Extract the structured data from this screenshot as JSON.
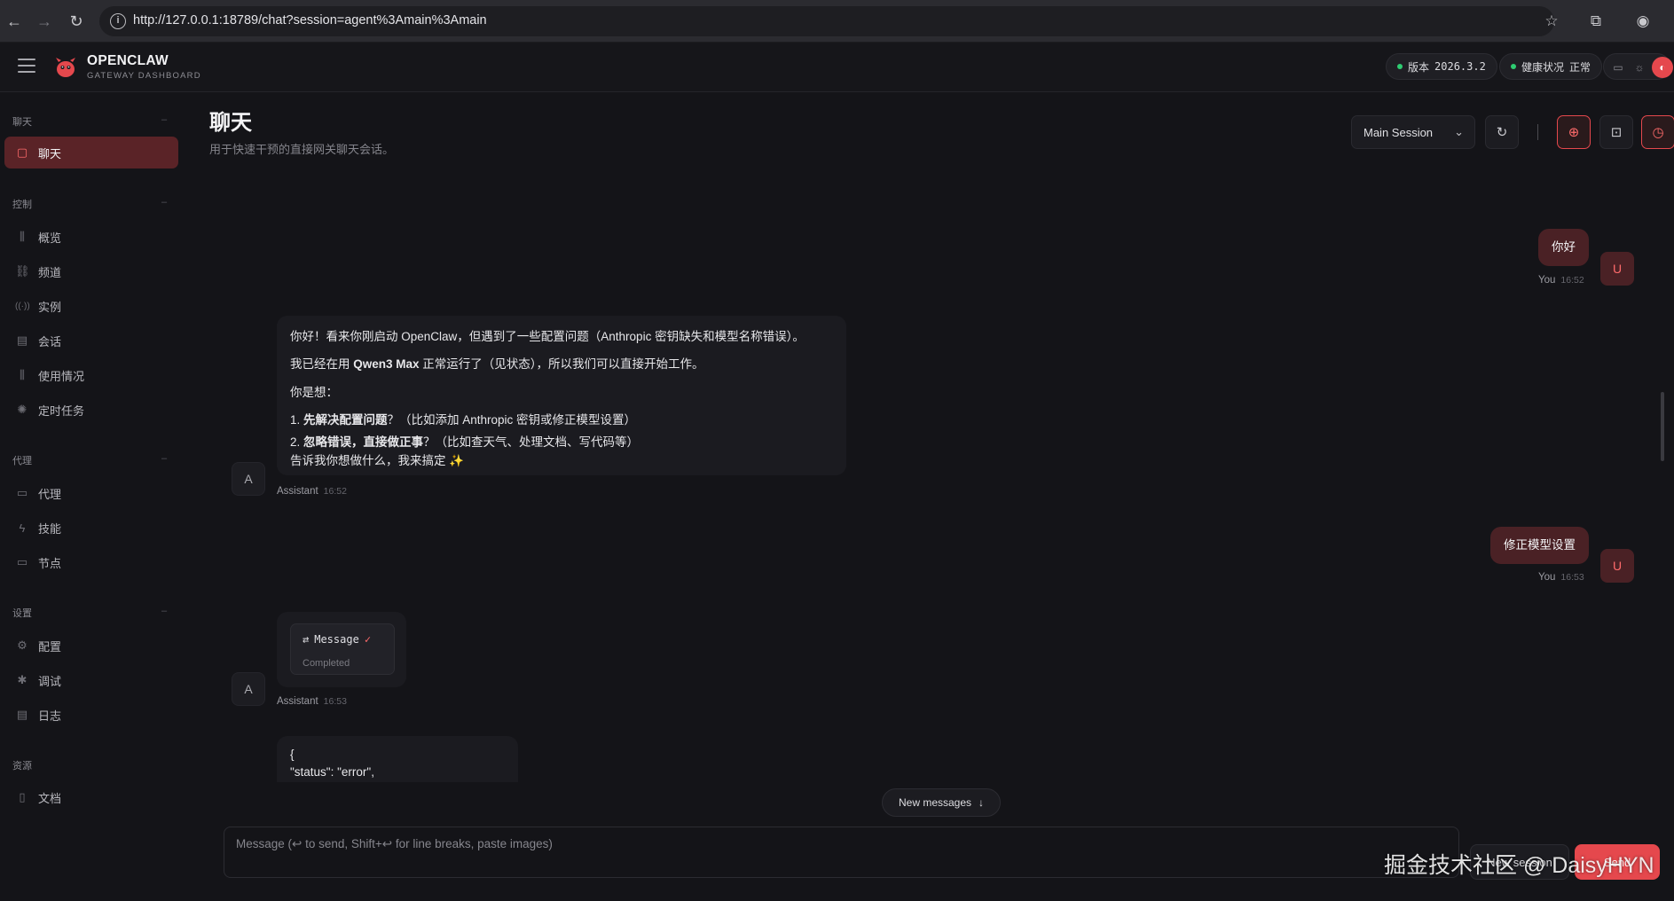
{
  "browser": {
    "url": "http://127.0.0.1:18789/chat?session=agent%3Amain%3Amain",
    "back_icon": "←",
    "forward_icon": "→",
    "reload_icon": "↻",
    "info_icon": "i",
    "star_icon": "☆",
    "extensions_icon": "⧉",
    "profile_icon": "◉"
  },
  "app": {
    "brand_title": "OPENCLAW",
    "brand_subtitle": "GATEWAY DASHBOARD",
    "version_label": "版本",
    "version_value": "2026.3.2",
    "health_label": "健康状况",
    "health_value": "正常",
    "status_color": "#2ecc71",
    "accent_color": "#e5484d",
    "theme_icons": [
      "▭",
      "☼",
      "◐"
    ]
  },
  "sidebar": {
    "sections": [
      {
        "title": "聊天",
        "items": [
          {
            "label": "聊天",
            "icon": "chat-icon",
            "glyph": "▢",
            "active": true
          }
        ]
      },
      {
        "title": "控制",
        "items": [
          {
            "label": "概览",
            "icon": "bar-chart-icon",
            "glyph": "⫼"
          },
          {
            "label": "频道",
            "icon": "link-icon",
            "glyph": "⛓"
          },
          {
            "label": "实例",
            "icon": "radio-icon",
            "glyph": "((·))"
          },
          {
            "label": "会话",
            "icon": "document-icon",
            "glyph": "▤"
          },
          {
            "label": "使用情况",
            "icon": "usage-chart-icon",
            "glyph": "⫼"
          },
          {
            "label": "定时任务",
            "icon": "loader-icon",
            "glyph": "✺"
          }
        ]
      },
      {
        "title": "代理",
        "items": [
          {
            "label": "代理",
            "icon": "folder-icon",
            "glyph": "▭"
          },
          {
            "label": "技能",
            "icon": "zap-icon",
            "glyph": "ϟ"
          },
          {
            "label": "节点",
            "icon": "monitor-icon",
            "glyph": "▭"
          }
        ]
      },
      {
        "title": "设置",
        "items": [
          {
            "label": "配置",
            "icon": "settings-icon",
            "glyph": "⚙"
          },
          {
            "label": "调试",
            "icon": "bug-icon",
            "glyph": "✱"
          },
          {
            "label": "日志",
            "icon": "scroll-icon",
            "glyph": "▤"
          }
        ]
      },
      {
        "title": "资源",
        "items": [
          {
            "label": "文档",
            "icon": "book-icon",
            "glyph": "▯"
          }
        ]
      }
    ]
  },
  "header": {
    "title": "聊天",
    "subtitle": "用于快速干预的直接网关聊天会话。",
    "session_select": "Main Session",
    "refresh_icon": "↻",
    "brain_icon": "⊕",
    "focus_icon": "⊡",
    "cron_icon": "◷"
  },
  "messages": [
    {
      "role": "user",
      "text": "你好",
      "sender": "You",
      "time": "16:52",
      "avatar": "U"
    },
    {
      "role": "assistant",
      "sender": "Assistant",
      "time": "16:52",
      "avatar": "A",
      "line1": "你好！看来你刚启动 OpenClaw，但遇到了一些配置问题（Anthropic 密钥缺失和模型名称错误）。",
      "line2_pre": "我已经在用 ",
      "line2_bold": "Qwen3 Max",
      "line2_post": " 正常运行了（见状态），所以我们可以直接开始工作。",
      "line3": "你是想：",
      "opt1_num": "1. ",
      "opt1_bold": "先解决配置问题",
      "opt1_rest": "？（比如添加 Anthropic 密钥或修正模型设置）",
      "opt2_num": "2. ",
      "opt2_bold": "忽略错误，直接做正事",
      "opt2_rest": "？（比如查天气、处理文档、写代码等）",
      "line4": "告诉我你想做什么，我来搞定 ✨"
    },
    {
      "role": "user",
      "text": "修正模型设置",
      "sender": "You",
      "time": "16:53",
      "avatar": "U"
    },
    {
      "role": "assistant",
      "sender": "Assistant",
      "time": "16:53",
      "avatar": "A",
      "tool_name": "Message",
      "tool_status": "Completed",
      "tool_icon": "⇄",
      "tool_check": "✓"
    },
    {
      "role": "assistant",
      "code_line1": "{",
      "code_line2": "\"status\": \"error\","
    }
  ],
  "new_messages": "New messages",
  "new_messages_icon": "↓",
  "composer": {
    "placeholder": "Message (↩ to send, Shift+↩ for line breaks, paste images)",
    "new_session_label": "New session",
    "send_label": "Send"
  },
  "watermark": "掘金技术社区 @ DaisyHYN"
}
